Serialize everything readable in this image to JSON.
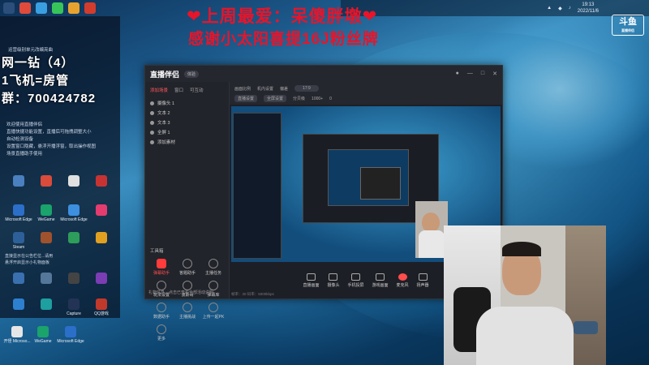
{
  "desktop": {
    "headline_line1": "上周最爱：呆傻胖墩",
    "headline_line2": "感谢小太阳喜提16J粉丝牌",
    "overlay_line1": "网一钻（4）",
    "overlay_line2": "1飞机=房管",
    "overlay_line3": "群：700424782",
    "tip_top": "运营级别单元改编亮曲",
    "tips": [
      "欢迎使用直播伴侣",
      "直播快捷功能设置，直播后可拖拽调整大小",
      "自动检测设备",
      "设置窗口隐藏，悬浮开播浮窗，取出操作视图",
      "场景直播助手使用"
    ],
    "tip_bottom_1": "直接显示在公告栏位...请用",
    "tip_bottom_2": "悬浮开启显示小礼物面板",
    "icons": [
      {
        "label": "Microsoft Edge"
      },
      {
        "label": "WeGame"
      },
      {
        "label": "Microsoft Edge"
      },
      {
        "label": "Steam"
      },
      {
        "label": "Capture"
      },
      {
        "label": "QQ游戏"
      }
    ],
    "bottom_icons": [
      "开怪 Microso...",
      "WeGame",
      "Microsoft Edge"
    ],
    "tray_time": "19:13",
    "tray_date": "2022/11/6",
    "brand": "斗鱼",
    "brand_sub": "直播伴侣"
  },
  "app": {
    "name": "直播伴侣",
    "badge": "体验",
    "left_tabs": [
      "添加场景",
      "窗口",
      "可互动"
    ],
    "sources": [
      "摄像头 1",
      "文本 2",
      "文本 3",
      "全屏 1",
      "添加素材"
    ],
    "tools_title": "工具箱",
    "tools": [
      {
        "label": "弹幕助手",
        "active": true
      },
      {
        "label": "答题助手",
        "active": false
      },
      {
        "label": "主播任务",
        "active": false
      },
      {
        "label": "玩法设置",
        "active": false
      },
      {
        "label": "波斯哥",
        "active": false
      },
      {
        "label": "弹幕库",
        "active": false
      },
      {
        "label": "数据助手",
        "active": false
      },
      {
        "label": "主播挑战",
        "active": false
      },
      {
        "label": "上传一起PK",
        "active": false
      },
      {
        "label": "更多",
        "active": false
      }
    ],
    "notice": "礼物信息，点击已查看全部活动说明",
    "topbar": {
      "row1": [
        "画面比例",
        "机内设置",
        "偏差",
        "17:9"
      ],
      "row2": [
        "直播设置",
        "全屏设置",
        "分贝级",
        "1000+",
        "0"
      ]
    },
    "bottom_buttons": [
      {
        "label": "直播画面",
        "red": false
      },
      {
        "label": "摄像头",
        "red": false
      },
      {
        "label": "手机投屏",
        "red": false
      },
      {
        "label": "游戏画面",
        "red": false
      },
      {
        "label": "麦克风",
        "red": true
      },
      {
        "label": "扬声器",
        "red": false
      }
    ],
    "statusline": "帧率：30  码率：5000kbps"
  }
}
